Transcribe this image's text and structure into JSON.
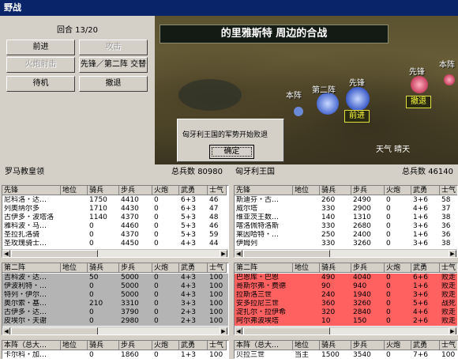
{
  "window": {
    "title": "野战"
  },
  "turn": {
    "label": "回合 13/20"
  },
  "buttons": {
    "advance": "前进",
    "attack": "攻击",
    "artillery": "火炮射击",
    "vanguard_swap": "先锋／第二阵 交替",
    "standby": "待机",
    "retreat": "撤退"
  },
  "map": {
    "battle_title": "的里雅斯特 周边的合战",
    "labels": {
      "hq": "本阵",
      "second": "第二阵",
      "vanguard_left": "先锋",
      "vanguard_right": "先锋",
      "hq_right": "本阵",
      "advance_tag": "前进",
      "retreat_tag": "撤退"
    },
    "weather": "天气 晴天"
  },
  "dialog": {
    "message": "匈牙利王国的军势开始败退",
    "ok": "确定"
  },
  "left_side": {
    "name": "罗马教皇领",
    "total_label": "总兵数",
    "total": "80980"
  },
  "right_side": {
    "name": "匈牙利王国",
    "total_label": "总兵数",
    "total": "46140"
  },
  "columns": [
    "地位",
    "骑兵",
    "步兵",
    "火炮",
    "武勇",
    "士气"
  ],
  "tables": {
    "left_vanguard": {
      "title": "先锋",
      "rows": [
        [
          "尼科洛・达…",
          "",
          "1750",
          "4410",
          "0",
          "6+3",
          "46"
        ],
        [
          "列奥纳尔多",
          "",
          "1710",
          "4430",
          "0",
          "6+3",
          "47"
        ],
        [
          "古伊多・波塔洛",
          "",
          "1140",
          "4370",
          "0",
          "5+3",
          "48"
        ],
        [
          "雅科波・马…",
          "",
          "0",
          "4460",
          "0",
          "5+3",
          "46"
        ],
        [
          "圣拉扎洛骑",
          "",
          "0",
          "4370",
          "0",
          "5+3",
          "59"
        ],
        [
          "圣玫瑰骑士…",
          "",
          "0",
          "4450",
          "0",
          "4+3",
          "44"
        ]
      ]
    },
    "right_vanguard": {
      "title": "先锋",
      "rows": [
        [
          "斯迪芬・古…",
          "",
          "260",
          "2490",
          "0",
          "3+6",
          "58"
        ],
        [
          "威尔塔",
          "",
          "330",
          "2900",
          "0",
          "4+6",
          "37"
        ],
        [
          "维亚茨王数…",
          "",
          "140",
          "1310",
          "0",
          "1+6",
          "38"
        ],
        [
          "喀洛佩特洛斯",
          "",
          "330",
          "2680",
          "0",
          "3+6",
          "36"
        ],
        [
          "莱因哈特・…",
          "",
          "250",
          "2400",
          "0",
          "1+6",
          "36"
        ],
        [
          "伊姆列",
          "",
          "330",
          "3260",
          "0",
          "3+6",
          "38"
        ]
      ]
    },
    "left_second": {
      "title": "第二阵",
      "rows": [
        [
          "吉科波・达…",
          "",
          "50",
          "5000",
          "0",
          "4+3",
          "100"
        ],
        [
          "伊波利特・…",
          "",
          "0",
          "5000",
          "0",
          "4+3",
          "100"
        ],
        [
          "特列・伊尔…",
          "",
          "0",
          "5000",
          "0",
          "4+3",
          "100"
        ],
        [
          "奥尔索・基…",
          "",
          "210",
          "3310",
          "0",
          "3+3",
          "100"
        ],
        [
          "古伊多・达…",
          "",
          "0",
          "3790",
          "0",
          "2+3",
          "100"
        ],
        [
          "皮埃尔・夫谢",
          "",
          "0",
          "2980",
          "0",
          "2+3",
          "100"
        ]
      ]
    },
    "right_second": {
      "title": "第二阵",
      "rows": [
        [
          "巴恩库・巴恩",
          "",
          "490",
          "4040",
          "0",
          "6+6",
          "败走"
        ],
        [
          "哥斯尔弗・费德",
          "",
          "90",
          "940",
          "0",
          "1+6",
          "败走"
        ],
        [
          "拉斯洛三世",
          "",
          "240",
          "1940",
          "0",
          "3+6",
          "败走"
        ],
        [
          "安多拉尼三世",
          "",
          "360",
          "3260",
          "0",
          "5+6",
          "战死"
        ],
        [
          "淀扎尔・拉伊希",
          "",
          "320",
          "2840",
          "0",
          "4+6",
          "败走"
        ],
        [
          "阿尔弗波埃塔",
          "",
          "10",
          "150",
          "0",
          "2+6",
          "败走"
        ]
      ]
    },
    "left_hq": {
      "title": "本阵（总大…",
      "rows": [
        [
          "卡尔科・加…",
          "",
          "0",
          "1860",
          "0",
          "1+3",
          "100"
        ]
      ]
    },
    "right_hq": {
      "title": "本阵（总大…",
      "rows": [
        [
          "贝拉三世",
          "当主",
          "1500",
          "3540",
          "0",
          "7+6",
          "100"
        ]
      ]
    }
  },
  "colors": {
    "titlebar": "#0a246a",
    "routed_row": "#ff6060",
    "table_gray": "#b4b4b4"
  }
}
